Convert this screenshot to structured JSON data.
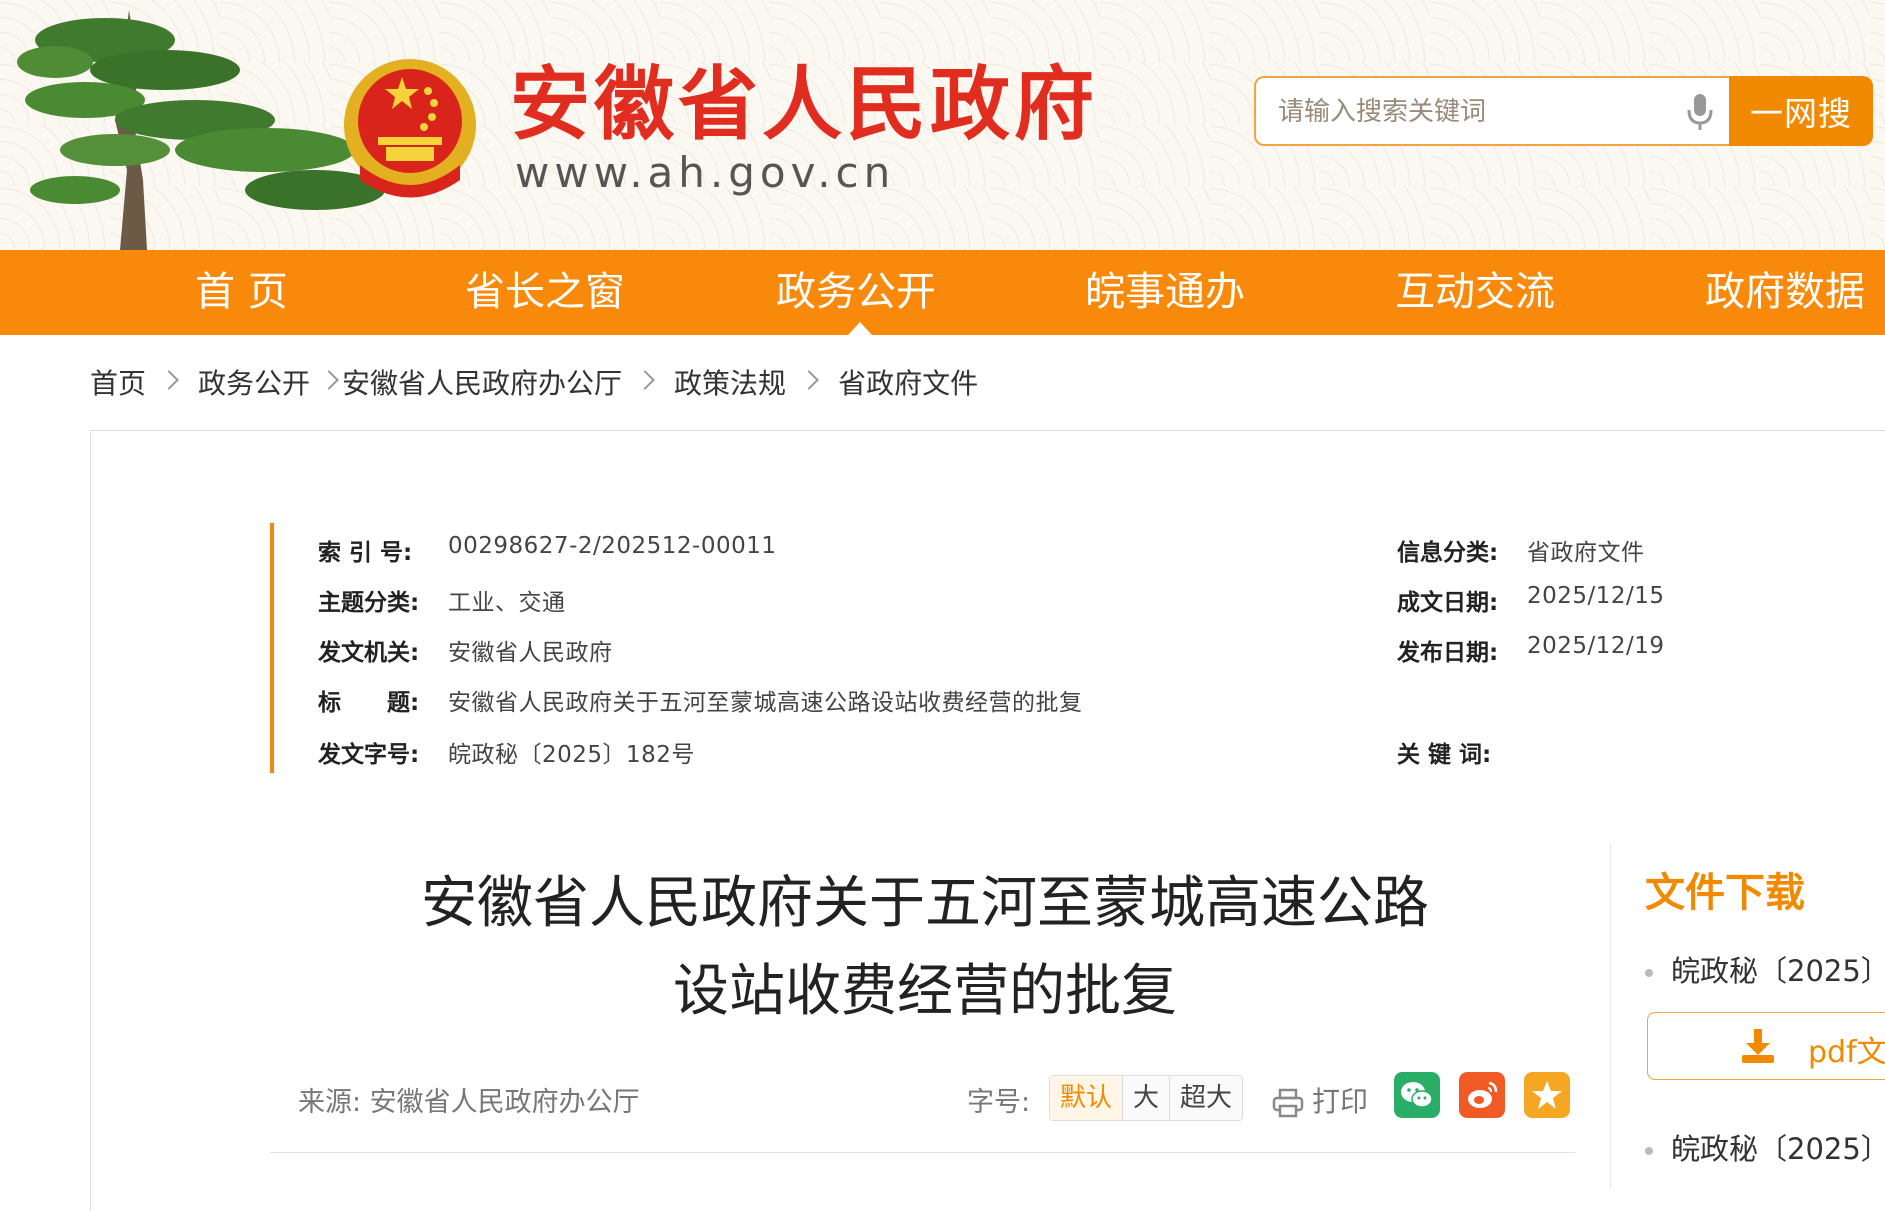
{
  "header": {
    "site_title": "安徽省人民政府",
    "site_url": "www.ah.gov.cn",
    "search_placeholder": "请输入搜索关键词",
    "search_button": "一网搜",
    "icons": [
      "pine-tree-logo",
      "national-emblem",
      "microphone-icon"
    ]
  },
  "nav": {
    "items": [
      "首 页",
      "省长之窗",
      "政务公开",
      "皖事通办",
      "互动交流",
      "政府数据"
    ],
    "active": "政务公开"
  },
  "breadcrumb": [
    "首页",
    "政务公开",
    "安徽省人民政府办公厅",
    "政策法规",
    "省政府文件"
  ],
  "meta": {
    "index_label": "索 引 号:",
    "index_value": "00298627-2/202512-00011",
    "category_label": "信息分类:",
    "category_value": "省政府文件",
    "topic_label": "主题分类:",
    "topic_value": "工业、交通",
    "written_label": "成文日期:",
    "written_value": "2025/12/15",
    "issuer_label": "发文机关:",
    "issuer_value": "安徽省人民政府",
    "published_label": "发布日期:",
    "published_value": "2025/12/19",
    "title_label": "标　　题:",
    "title_value": "安徽省人民政府关于五河至蒙城高速公路设站收费经营的批复",
    "docno_label": "发文字号:",
    "docno_value": "皖政秘〔2025〕182号",
    "keywords_label": "关 键 词:",
    "keywords_value": ""
  },
  "article": {
    "title_line1": "安徽省人民政府关于五河至蒙城高速公路",
    "title_line2": "设站收费经营的批复",
    "source": "来源: 安徽省人民政府办公厅",
    "font_size_label": "字号:",
    "font_sizes": [
      "默认",
      "大",
      "超大"
    ],
    "active_font_size": "默认",
    "print_label": "打印",
    "share_icons": [
      "wechat-icon",
      "weibo-icon",
      "favorite-icon"
    ],
    "colors": {
      "wechat": "#2aae67",
      "weibo": "#f05a24",
      "favorite": "#f5a623"
    }
  },
  "sidebar": {
    "download_title": "文件下载",
    "items": [
      "皖政秘〔2025〕",
      "皖政秘〔2025〕"
    ],
    "pdf_button": "pdf文"
  },
  "colors": {
    "accent": "#f18a00",
    "title_red": "#e12d1f"
  }
}
